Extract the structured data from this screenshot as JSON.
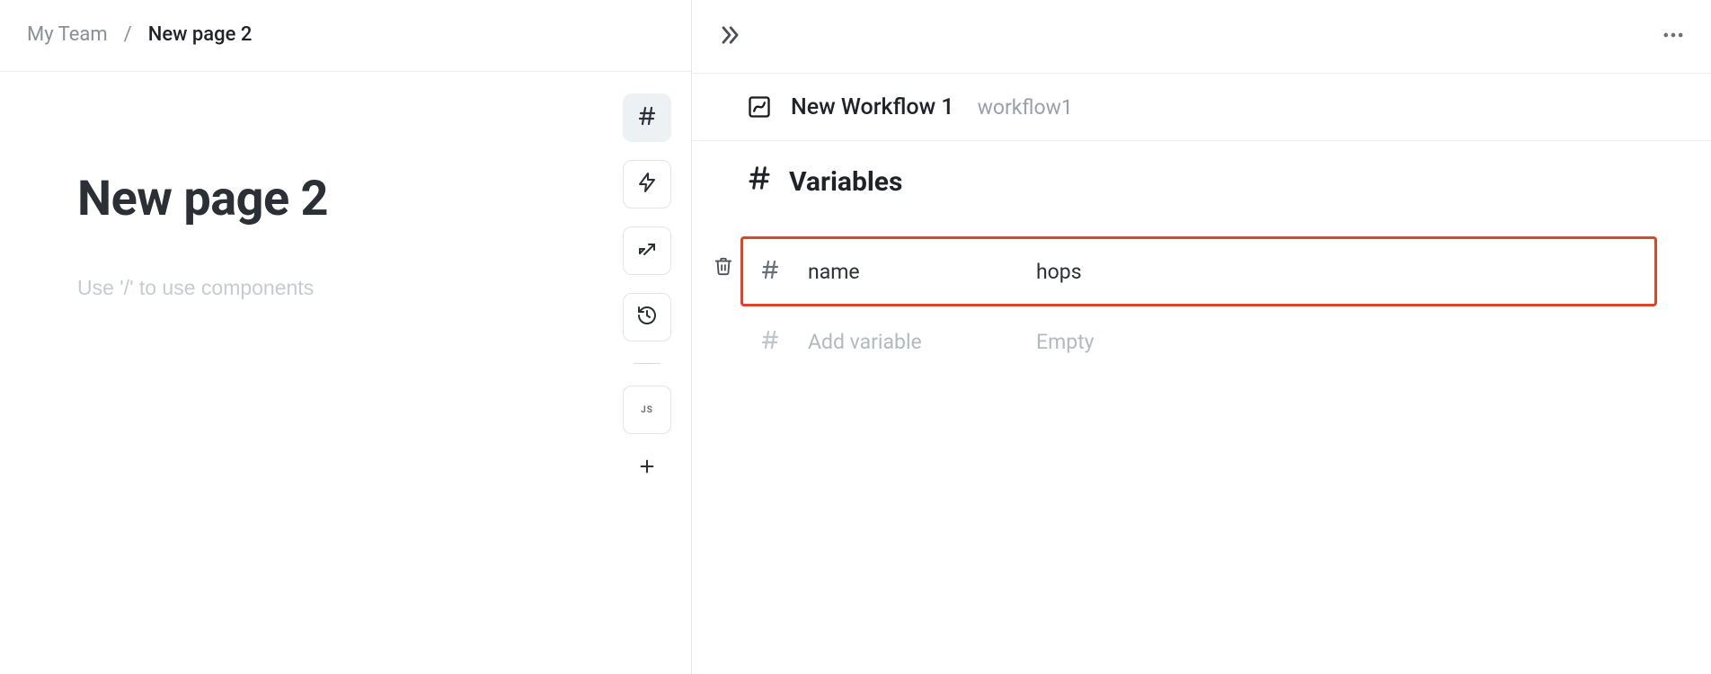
{
  "breadcrumb": {
    "team": "My Team",
    "separator": "/",
    "page": "New page 2"
  },
  "page": {
    "title": "New page 2",
    "editor_placeholder": "Use '/' to use components"
  },
  "toolbar": {
    "items": [
      {
        "id": "hash",
        "icon": "hash-icon",
        "active": true
      },
      {
        "id": "bolt",
        "icon": "bolt-icon",
        "active": false
      },
      {
        "id": "swap",
        "icon": "swap-icon",
        "active": false
      },
      {
        "id": "history",
        "icon": "history-icon",
        "active": false
      }
    ],
    "js_label": "JS",
    "add_label": "+"
  },
  "workflow": {
    "title": "New Workflow 1",
    "id": "workflow1"
  },
  "variables_section": {
    "heading": "Variables"
  },
  "variables": [
    {
      "name": "name",
      "value": "hops",
      "selected": true
    }
  ],
  "add_variable": {
    "name_placeholder": "Add variable",
    "value_placeholder": "Empty"
  }
}
